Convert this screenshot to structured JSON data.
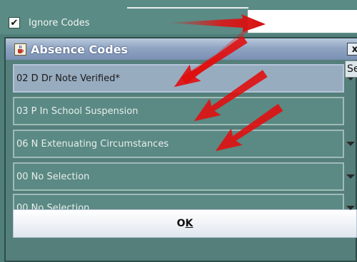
{
  "top": {
    "ignore_codes_label": "Ignore Codes",
    "ignore_codes_checked": true
  },
  "dialog": {
    "title": "Absence Codes",
    "close_glyph": "x",
    "rows": [
      {
        "label": "02 D Dr Note Verified*",
        "selected": true
      },
      {
        "label": "03 P In School Suspension",
        "selected": false
      },
      {
        "label": "06 N Extenuating Circumstances",
        "selected": false
      },
      {
        "label": "00 No Selection",
        "selected": false
      },
      {
        "label": "00 No Selection",
        "selected": false
      }
    ],
    "tooltip_fragment": "Se",
    "ok_label": "OK",
    "ok_mnemonic": "K"
  },
  "icons": {
    "title_icon": "java-coffee-cup-icon",
    "dropdown": "caret-down-icon",
    "annotation": "red-arrow-icon"
  },
  "colors": {
    "background": "#4f7f78",
    "titlebar": "#8fa4c2",
    "selected_row": "#98acc0",
    "annotation_red": "#e01010"
  }
}
